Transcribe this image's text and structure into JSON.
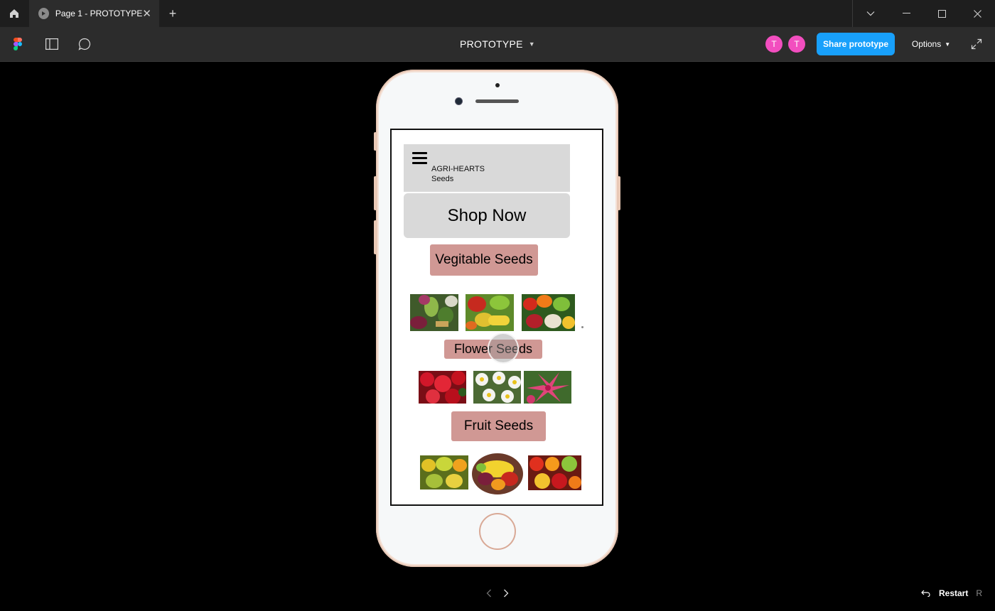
{
  "titlebar": {
    "tab_title": "Page 1 - PROTOTYPE",
    "tab_close": "✕",
    "new_tab": "+"
  },
  "toolbar": {
    "prototype_name": "PROTOTYPE",
    "avatars": [
      "T",
      "T"
    ],
    "share_label": "Share prototype",
    "options_label": "Options"
  },
  "app": {
    "brand_line1": "AGRI-HEARTS",
    "brand_line2": "Seeds",
    "shop_now": "Shop Now",
    "categories": {
      "vegetable": "Vegitable Seeds",
      "flower": "Flower Seeds",
      "fruit": "Fruit Seeds"
    }
  },
  "bottom": {
    "restart_label": "Restart",
    "restart_key": "R"
  },
  "colors": {
    "accent": "#18a0fb",
    "avatar": "#f24ebf",
    "category_pill": "#d09894",
    "header_gray": "#d9d9d9"
  }
}
